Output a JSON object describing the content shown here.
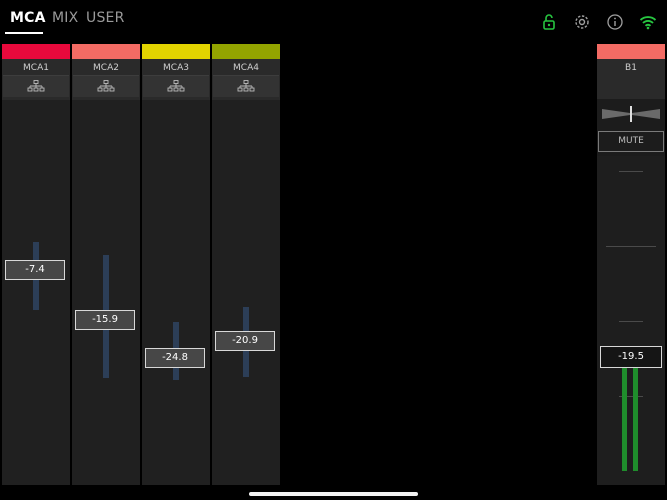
{
  "tabs": [
    {
      "label": "MCA",
      "active": true
    },
    {
      "label": "MIX",
      "active": false
    },
    {
      "label": "USER",
      "active": false
    }
  ],
  "status_icons": [
    {
      "name": "unlock-icon",
      "color": "#27c540"
    },
    {
      "name": "gear-icon",
      "color": "#a0a0a0"
    },
    {
      "name": "info-icon",
      "color": "#a0a0a0"
    },
    {
      "name": "wifi-icon",
      "color": "#27c540"
    }
  ],
  "channels": [
    {
      "name": "MCA1",
      "color": "#e8093c",
      "level": "-7.4",
      "icon": "network-icon"
    },
    {
      "name": "MCA2",
      "color": "#f36b64",
      "level": "-15.9",
      "icon": "network-icon"
    },
    {
      "name": "MCA3",
      "color": "#e2d400",
      "level": "-24.8",
      "icon": "network-icon"
    },
    {
      "name": "MCA4",
      "color": "#93a400",
      "level": "-20.9",
      "icon": "network-icon"
    }
  ],
  "bus": {
    "name": "B1",
    "color": "#f36b64",
    "mute_label": "MUTE",
    "level": "-19.5",
    "icon": "pan-icon"
  }
}
